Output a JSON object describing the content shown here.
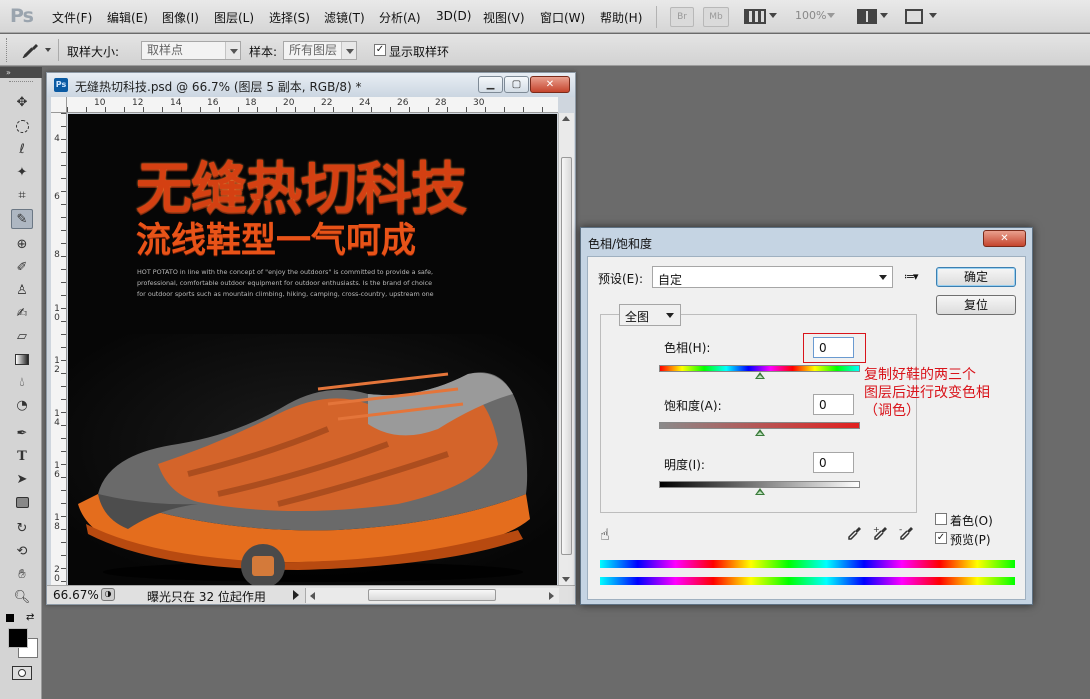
{
  "app": {
    "logo": "Ps"
  },
  "menu": [
    "文件(F)",
    "编辑(E)",
    "图像(I)",
    "图层(L)",
    "选择(S)",
    "滤镜(T)",
    "分析(A)",
    "3D(D)",
    "视图(V)",
    "窗口(W)",
    "帮助(H)"
  ],
  "menubar_right": {
    "br_label": "Br",
    "mb_label": "Mb",
    "zoom": "100%"
  },
  "options_bar": {
    "sample_size_label": "取样大小:",
    "sample_size_value": "取样点",
    "sample_label": "样本:",
    "sample_value": "所有图层",
    "show_ring_label": "显示取样环",
    "show_ring_checked": "✓"
  },
  "document": {
    "ps_badge": "Ps",
    "title": "无缝热切科技.psd @ 66.7% (图层 5 副本, RGB/8) *",
    "ruler_top": [
      "10",
      "12",
      "14",
      "16",
      "18",
      "20",
      "22",
      "24",
      "26",
      "28",
      "30"
    ],
    "ruler_left": [
      "4",
      "6",
      "8",
      "1\n0",
      "1\n2",
      "1\n4",
      "1\n6",
      "1\n8",
      "2\n0"
    ],
    "zoom": "66.67%",
    "status_text": "曝光只在 32 位起作用",
    "art": {
      "title1": "无缝热切科技",
      "title2": "流线鞋型一气呵成",
      "sub_lines": [
        "HOT POTATO in line with the concept of \"enjoy the outdoors\" is committed to provide a safe,",
        "professional, comfortable outdoor equipment for outdoor enthusiasts. Is the brand of choice",
        "for outdoor sports such as mountain climbing, hiking, camping, cross-country, upstream one"
      ]
    }
  },
  "dialog": {
    "title": "色相/饱和度",
    "preset_label": "预设(E):",
    "preset_value": "自定",
    "ok": "确定",
    "reset": "复位",
    "channel": "全图",
    "hue_label": "色相(H):",
    "hue_value": "0",
    "saturation_label": "饱和度(A):",
    "saturation_value": "0",
    "lightness_label": "明度(I):",
    "lightness_value": "0",
    "colorize_label": "着色(O)",
    "preview_label": "预览(P)",
    "preview_checked": "✓",
    "annotation": [
      "复制好鞋的两三个",
      "图层后进行改变色相",
      "（调色）"
    ],
    "hue_level": 0.5,
    "saturation_level": 0.5,
    "lightness_level": 0.5
  },
  "colors": {
    "annotation": "#d9141b",
    "highlight_box": "#d9141b"
  }
}
